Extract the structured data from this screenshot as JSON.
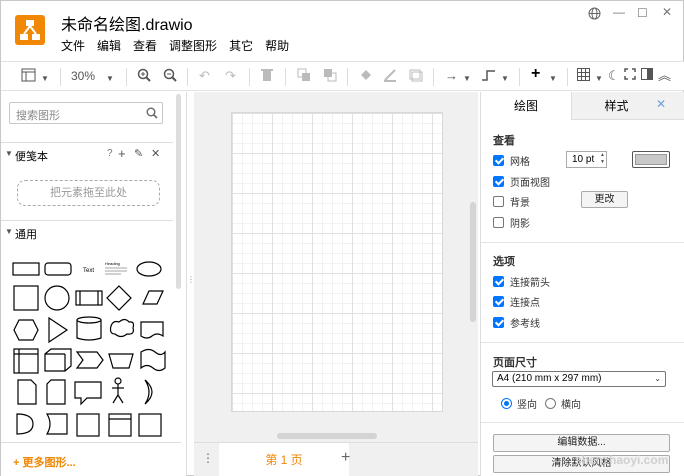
{
  "window": {
    "title": "未命名绘图.drawio",
    "controls": [
      "globe-icon",
      "minimize-icon",
      "maximize-icon",
      "close-icon"
    ]
  },
  "menu": [
    "文件",
    "编辑",
    "查看",
    "调整图形",
    "其它",
    "帮助"
  ],
  "toolbar": {
    "zoom": "30%"
  },
  "left": {
    "search_placeholder": "搜索图形",
    "scratchpad": {
      "title": "便笺本",
      "help": "?",
      "drop_hint": "把元素拖至此处"
    },
    "general": {
      "title": "通用"
    },
    "shape_text": {
      "text": "Text",
      "heading": "Heading"
    },
    "more_shapes": "+ 更多图形..."
  },
  "pages": {
    "current": "第 1 页"
  },
  "right": {
    "tabs": [
      "绘图",
      "样式"
    ],
    "view": {
      "title": "查看",
      "grid": {
        "label": "网格",
        "checked": true,
        "size": "10 pt"
      },
      "page_view": {
        "label": "页面视图",
        "checked": true
      },
      "background": {
        "label": "背景",
        "checked": false,
        "button": "更改"
      },
      "shadow": {
        "label": "阴影",
        "checked": false
      }
    },
    "options": {
      "title": "选项",
      "connection_arrows": {
        "label": "连接箭头",
        "checked": true
      },
      "connection_points": {
        "label": "连接点",
        "checked": true
      },
      "guides": {
        "label": "参考线",
        "checked": true
      }
    },
    "paper": {
      "title": "页面尺寸",
      "size": "A4 (210 mm x 297 mm)",
      "portrait": "竖向",
      "landscape": "横向",
      "orientation": "portrait"
    },
    "edit_data": "编辑数据...",
    "clear_default_style": "清除默认风格"
  },
  "watermark": "shenzhaoyi.com",
  "colors": {
    "accent": "#f08705",
    "checkbox": "#0075ff"
  }
}
